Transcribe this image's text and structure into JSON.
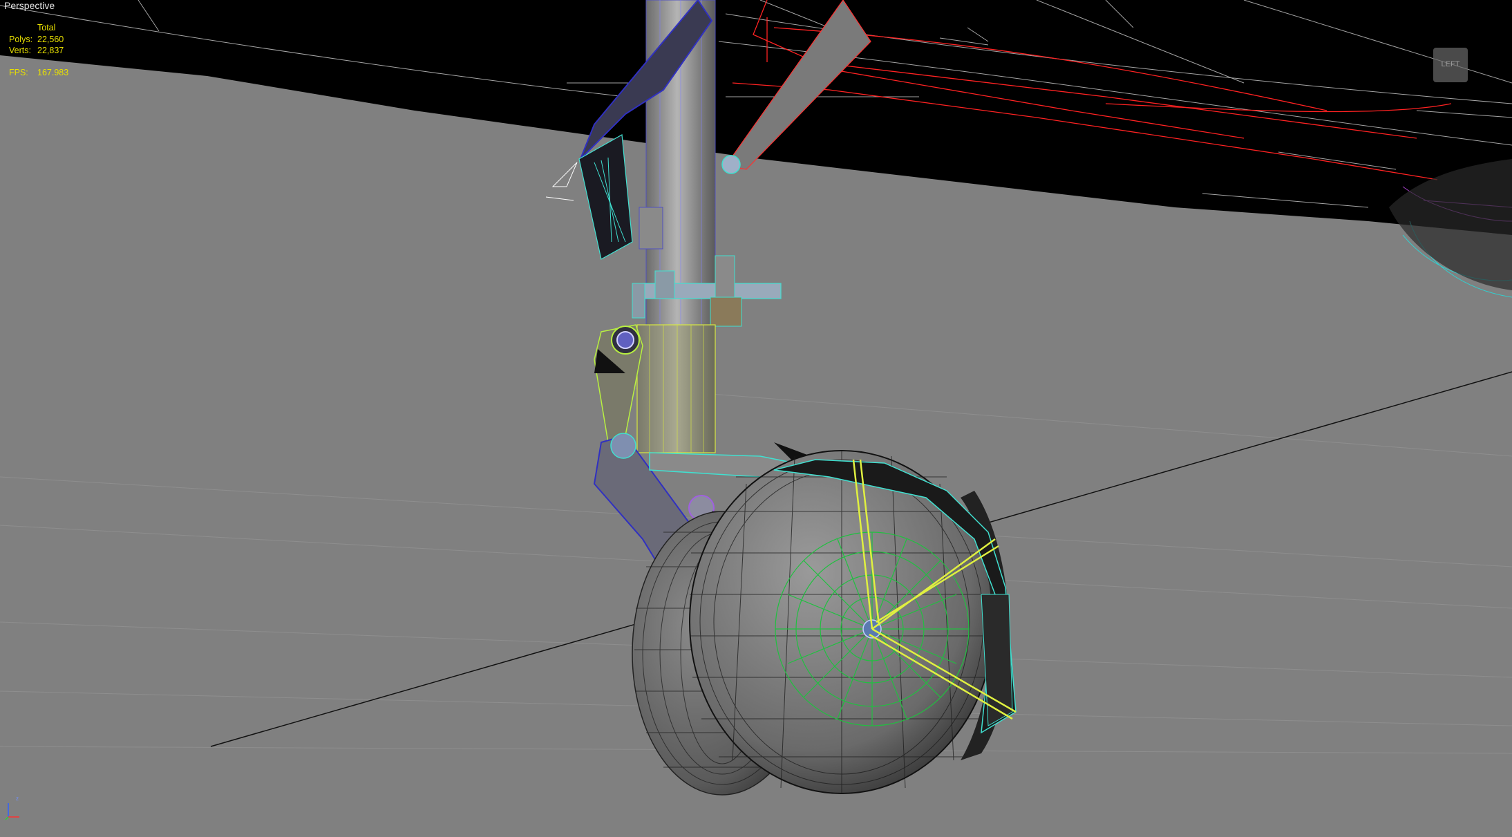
{
  "viewport": {
    "label": "Perspective",
    "stats": {
      "header": "Total",
      "polys_label": "Polys:",
      "polys_value": "22,560",
      "verts_label": "Verts:",
      "verts_value": "22,837",
      "fps_label": "FPS:",
      "fps_value": "167.983"
    },
    "viewcube_label": "LEFT",
    "axis_label": "z",
    "colors": {
      "background": "#808080",
      "stats_text": "#e8e000",
      "wing": "#000000",
      "wire_red": "#ff2020",
      "wire_cyan": "#40e0d0",
      "wire_yellow": "#e0f040",
      "wire_green": "#20c040",
      "wire_blue": "#2020b0"
    }
  }
}
